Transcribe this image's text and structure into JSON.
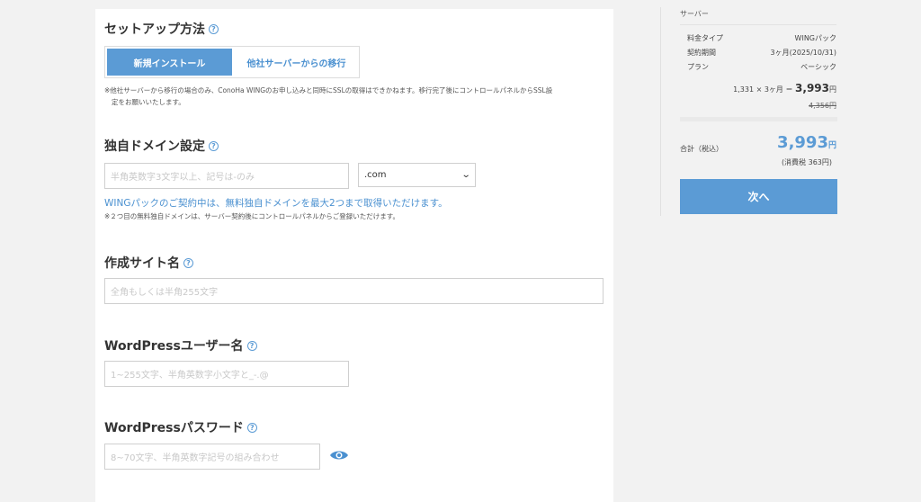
{
  "setup": {
    "title": "セットアップ方法",
    "tabs": [
      {
        "label": "新規インストール",
        "active": true
      },
      {
        "label": "他社サーバーからの移行",
        "active": false
      }
    ],
    "note_line1": "※他社サーバーから移行の場合のみ、ConoHa WINGのお申し込みと同時にSSLの取得はできかねます。移行完了後にコントロールパネルからSSL設",
    "note_line2": "定をお願いいたします。"
  },
  "domain": {
    "title": "独自ドメイン設定",
    "placeholder": "半角英数字3文字以上、記号は-のみ",
    "tld": ".com",
    "promo": "WINGパックのご契約中は、無料独自ドメインを最大2つまで取得いただけます。",
    "note": "※２つ目の無料独自ドメインは、サーバー契約後にコントロールパネルからご登録いただけます。"
  },
  "site": {
    "title": "作成サイト名",
    "placeholder": "全角もしくは半角255文字"
  },
  "wp_user": {
    "title": "WordPressユーザー名",
    "placeholder": "1~255文字、半角英数字小文字と_-.@"
  },
  "wp_pass": {
    "title": "WordPressパスワード",
    "placeholder": "8~70文字、半角英数字記号の組み合わせ"
  },
  "summary": {
    "header": "サーバー",
    "rows": [
      {
        "label": "料金タイプ",
        "value": "WINGパック"
      },
      {
        "label": "契約期間",
        "value": "3ヶ月(2025/10/31)"
      },
      {
        "label": "プラン",
        "value": "ベーシック"
      }
    ],
    "price_calc": "1,331 × 3ヶ月 ＝",
    "price_value": "3,993",
    "price_unit": "円",
    "original_price": "4,356円",
    "total_label": "合計（税込）",
    "total_value": "3,993",
    "total_unit": "円",
    "tax": "(消費税 363円)",
    "next_button": "次へ"
  },
  "colors": {
    "accent": "#5b9bd5",
    "link": "#4a90d0",
    "background": "#f2f2f2"
  }
}
